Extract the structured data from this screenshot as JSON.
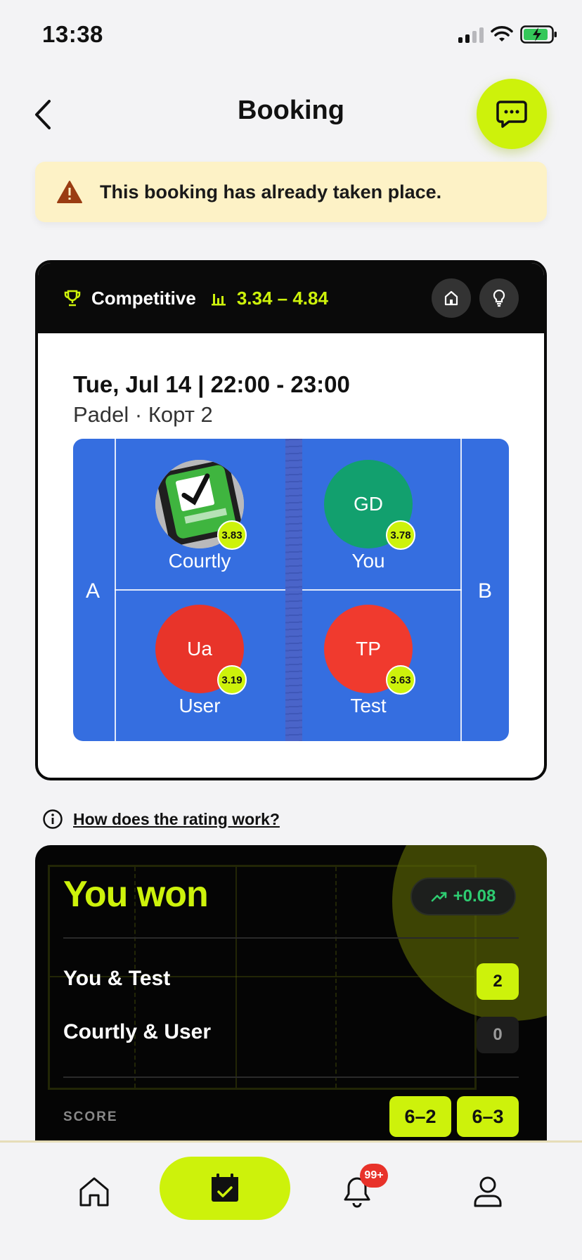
{
  "status_bar": {
    "time": "13:38"
  },
  "header": {
    "title": "Booking"
  },
  "alert": {
    "text": "This booking has already taken place."
  },
  "booking": {
    "type_label": "Competitive",
    "rating_range": "3.34 – 4.84",
    "date_time": "Tue, Jul 14 | 22:00 - 23:00",
    "place": "Padel · Корт 2",
    "side_a": "A",
    "side_b": "B",
    "players": [
      {
        "name": "Courtly",
        "initials": "",
        "rating": "3.83",
        "avatar_color": "#2e9d3a"
      },
      {
        "name": "You",
        "initials": "GD",
        "rating": "3.78",
        "avatar_color": "#12a06e"
      },
      {
        "name": "User",
        "initials": "Ua",
        "rating": "3.19",
        "avatar_color": "#e8342a"
      },
      {
        "name": "Test",
        "initials": "TP",
        "rating": "3.63",
        "avatar_color": "#f03a2e"
      }
    ]
  },
  "rating_info": {
    "link_text": "How does the rating work?"
  },
  "result": {
    "headline": "You won",
    "delta": "+0.08",
    "teams": [
      {
        "name": "You & Test",
        "score": "2"
      },
      {
        "name": "Courtly & User",
        "score": "0"
      }
    ],
    "score_label": "SCORE",
    "sets": [
      "6–2",
      "6–3"
    ]
  },
  "tabbar": {
    "notifications_badge": "99+"
  },
  "colors": {
    "accent": "#cdf20b",
    "court": "#356ee0",
    "positive": "#2ecc71"
  },
  "icons": [
    "back-icon",
    "chat-icon",
    "warning-icon",
    "trophy-icon",
    "rating-bars-icon",
    "home-venue-icon",
    "lightbulb-icon",
    "info-icon",
    "trend-up-icon",
    "home-icon",
    "calendar-check-icon",
    "bell-icon",
    "profile-icon"
  ]
}
